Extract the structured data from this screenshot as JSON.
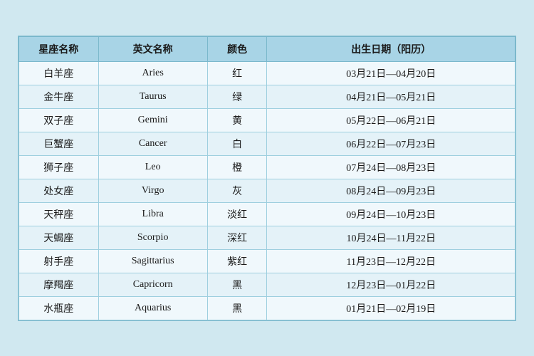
{
  "table": {
    "headers": [
      "星座名称",
      "英文名称",
      "颜色",
      "出生日期（阳历）"
    ],
    "rows": [
      {
        "cn": "白羊座",
        "en": "Aries",
        "color": "红",
        "date": "03月21日—04月20日"
      },
      {
        "cn": "金牛座",
        "en": "Taurus",
        "color": "绿",
        "date": "04月21日—05月21日"
      },
      {
        "cn": "双子座",
        "en": "Gemini",
        "color": "黄",
        "date": "05月22日—06月21日"
      },
      {
        "cn": "巨蟹座",
        "en": "Cancer",
        "color": "白",
        "date": "06月22日—07月23日"
      },
      {
        "cn": "狮子座",
        "en": "Leo",
        "color": "橙",
        "date": "07月24日—08月23日"
      },
      {
        "cn": "处女座",
        "en": "Virgo",
        "color": "灰",
        "date": "08月24日—09月23日"
      },
      {
        "cn": "天秤座",
        "en": "Libra",
        "color": "淡红",
        "date": "09月24日—10月23日"
      },
      {
        "cn": "天蝎座",
        "en": "Scorpio",
        "color": "深红",
        "date": "10月24日—11月22日"
      },
      {
        "cn": "射手座",
        "en": "Sagittarius",
        "color": "紫红",
        "date": "11月23日—12月22日"
      },
      {
        "cn": "摩羯座",
        "en": "Capricorn",
        "color": "黑",
        "date": "12月23日—01月22日"
      },
      {
        "cn": "水瓶座",
        "en": "Aquarius",
        "color": "黑",
        "date": "01月21日—02月19日"
      }
    ]
  }
}
